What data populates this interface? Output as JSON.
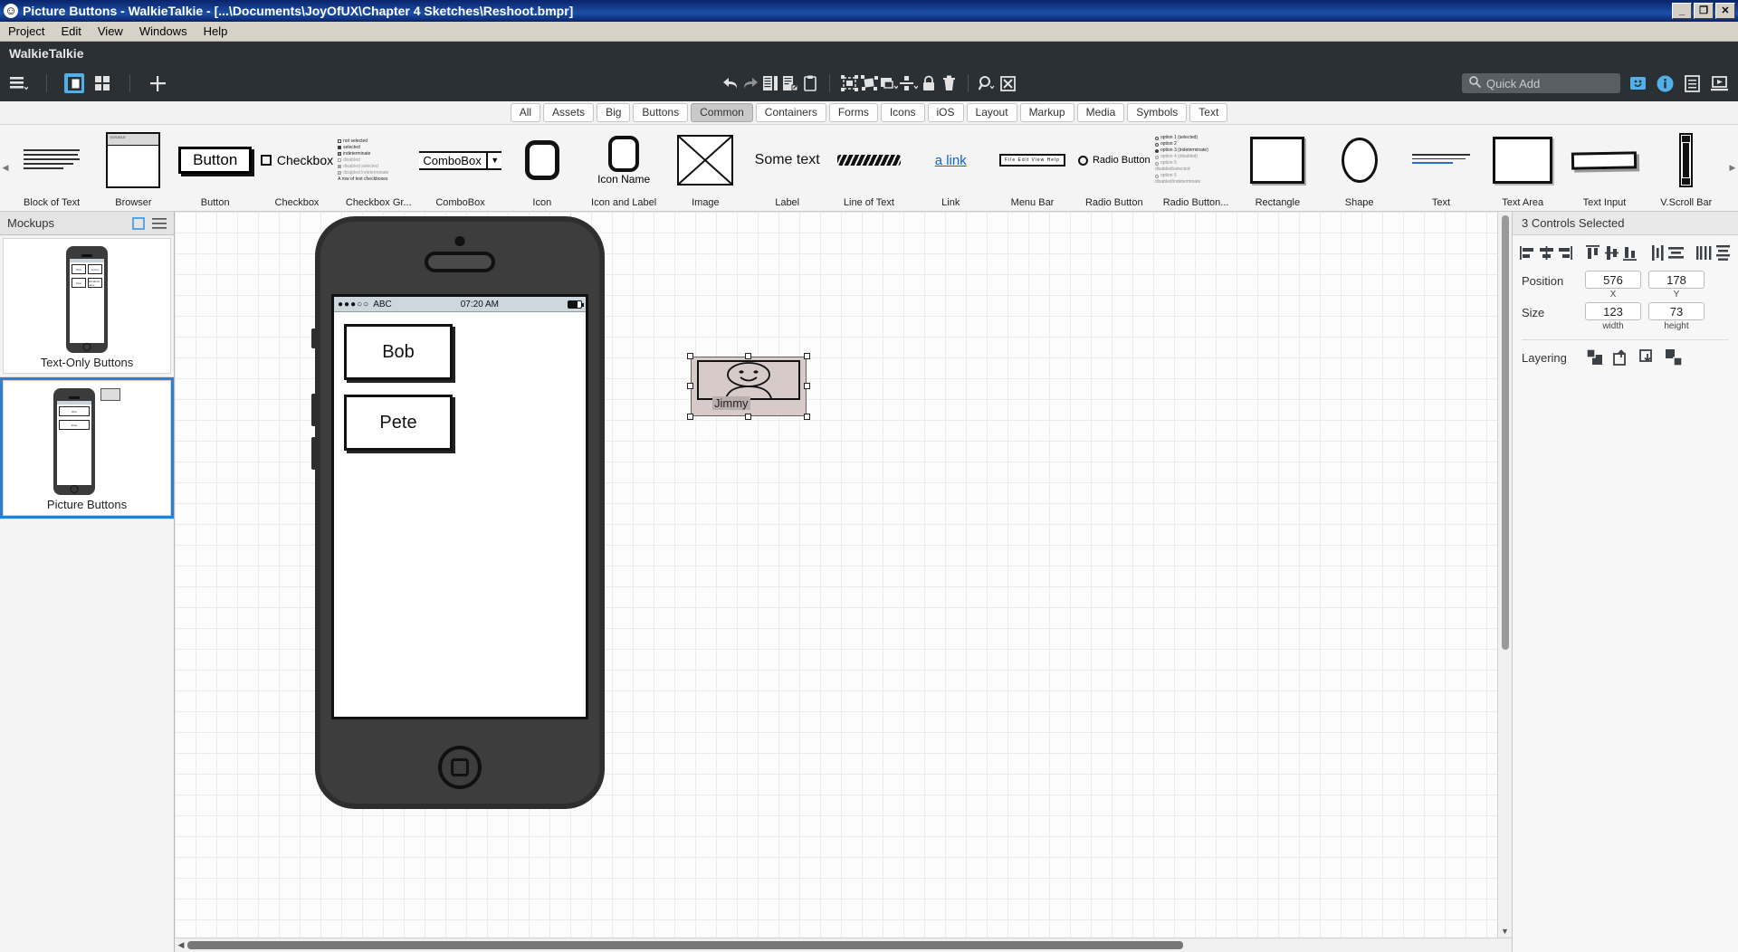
{
  "window": {
    "title": "Picture Buttons - WalkieTalkie - [...\\Documents\\JoyOfUX\\Chapter 4 Sketches\\Reshoot.bmpr]",
    "app_icon": "smiley-icon",
    "minimize": "_",
    "maximize": "❐",
    "close": "✕"
  },
  "menubar": {
    "items": [
      "Project",
      "Edit",
      "View",
      "Windows",
      "Help"
    ]
  },
  "project": {
    "name": "WalkieTalkie"
  },
  "toolbar": {
    "left_icons": [
      "hamburger-menu-icon",
      "panel-toggle-icon",
      "grid-view-icon",
      "add-mockup-icon"
    ],
    "center_icons": [
      "undo-icon",
      "redo-icon",
      "duplicate-icon",
      "copy-to-icon",
      "clipboard-icon",
      "group-icon",
      "ungroup-icon",
      "layer-icon",
      "align-distribute-icon",
      "lock-icon",
      "delete-icon",
      "zoom-icon",
      "clear-zoom-icon"
    ],
    "quick_add_placeholder": "Quick Add",
    "right_icons": [
      "quick-add-widget-icon",
      "info-icon",
      "notes-icon",
      "presentation-icon"
    ]
  },
  "categories": {
    "items": [
      "All",
      "Assets",
      "Big",
      "Buttons",
      "Common",
      "Containers",
      "Forms",
      "Icons",
      "iOS",
      "Layout",
      "Markup",
      "Media",
      "Symbols",
      "Text"
    ],
    "selected": "Common"
  },
  "palette": {
    "items": [
      {
        "label": "Block of Text",
        "kind": "block-of-text"
      },
      {
        "label": "Browser",
        "kind": "browser",
        "url": "GOOGLE"
      },
      {
        "label": "Button",
        "kind": "button",
        "text": "Button"
      },
      {
        "label": "Checkbox",
        "kind": "checkbox",
        "text": "Checkbox"
      },
      {
        "label": "Checkbox Gr...",
        "kind": "checkbox-group",
        "lines": [
          "not selected",
          "selected",
          "indeterminate",
          "disabled",
          "disabled selected",
          "disabled indeterminate",
          "A row of text checkboxes"
        ]
      },
      {
        "label": "ComboBox",
        "kind": "combobox",
        "text": "ComboBox"
      },
      {
        "label": "Icon",
        "kind": "icon"
      },
      {
        "label": "Icon and Label",
        "kind": "icon-and-label",
        "text": "Icon Name"
      },
      {
        "label": "Image",
        "kind": "image"
      },
      {
        "label": "Label",
        "kind": "label",
        "text": "Some text"
      },
      {
        "label": "Line of Text",
        "kind": "line-of-text"
      },
      {
        "label": "Link",
        "kind": "link",
        "text": "a link"
      },
      {
        "label": "Menu Bar",
        "kind": "menu-bar",
        "text": "File  Edit  View  Help"
      },
      {
        "label": "Radio Button",
        "kind": "radio-button",
        "text": "Radio Button"
      },
      {
        "label": "Radio Button...",
        "kind": "radio-button-group",
        "lines": [
          "option 1 (selected)",
          "option 2",
          "option 3 (indeterminate)",
          "option 4 (disabled)",
          "option 5",
          "disabled/selected",
          "option 6",
          "disabled/indeterminate"
        ]
      },
      {
        "label": "Rectangle",
        "kind": "rectangle"
      },
      {
        "label": "Shape",
        "kind": "shape"
      },
      {
        "label": "Text",
        "kind": "text"
      },
      {
        "label": "Text Area",
        "kind": "text-area"
      },
      {
        "label": "Text Input",
        "kind": "text-input"
      },
      {
        "label": "V.Scroll Bar",
        "kind": "vscrollbar"
      }
    ]
  },
  "sidebar": {
    "title": "Mockups",
    "header_icons": [
      "new-mockup-icon",
      "list-menu-icon"
    ],
    "items": [
      {
        "name": "Text-Only Buttons",
        "selected": false,
        "preview_buttons": [
          "Bob",
          "Jimmy",
          "Pete",
          "Elizabeth Jane"
        ]
      },
      {
        "name": "Picture Buttons",
        "selected": true,
        "preview_buttons": [
          "Bob",
          "Pete"
        ]
      }
    ]
  },
  "canvas": {
    "phone": {
      "status_bar": {
        "signal": "●●●○○",
        "carrier": "ABC",
        "time": "07:20 AM",
        "battery": "battery-icon"
      },
      "buttons": [
        "Bob",
        "Pete"
      ]
    },
    "selection": {
      "label": "Jimmy",
      "image": "smiley-person-icon",
      "handle_count": 8
    }
  },
  "properties": {
    "header": "3 Controls Selected",
    "align_icons": [
      "align-left-icon",
      "align-center-h-icon",
      "align-right-icon",
      "align-top-icon",
      "align-middle-v-icon",
      "align-bottom-icon",
      "distribute-h-icon",
      "distribute-v-icon",
      "spacing-h-icon",
      "spacing-v-icon"
    ],
    "position": {
      "label": "Position",
      "x": "576",
      "y": "178",
      "x_sub": "X",
      "y_sub": "Y"
    },
    "size": {
      "label": "Size",
      "width": "123",
      "height": "73",
      "width_sub": "width",
      "height_sub": "height"
    },
    "layering": {
      "label": "Layering",
      "icons": [
        "bring-to-front-icon",
        "bring-forward-icon",
        "send-backward-icon",
        "send-to-back-icon"
      ]
    }
  },
  "colors": {
    "titlebar": "#0a246a",
    "dark_toolbar": "#2b3034",
    "accent_blue": "#52b0e8",
    "selection_blue": "#2f7fd1",
    "selected_fill": "#d6cbc9"
  }
}
